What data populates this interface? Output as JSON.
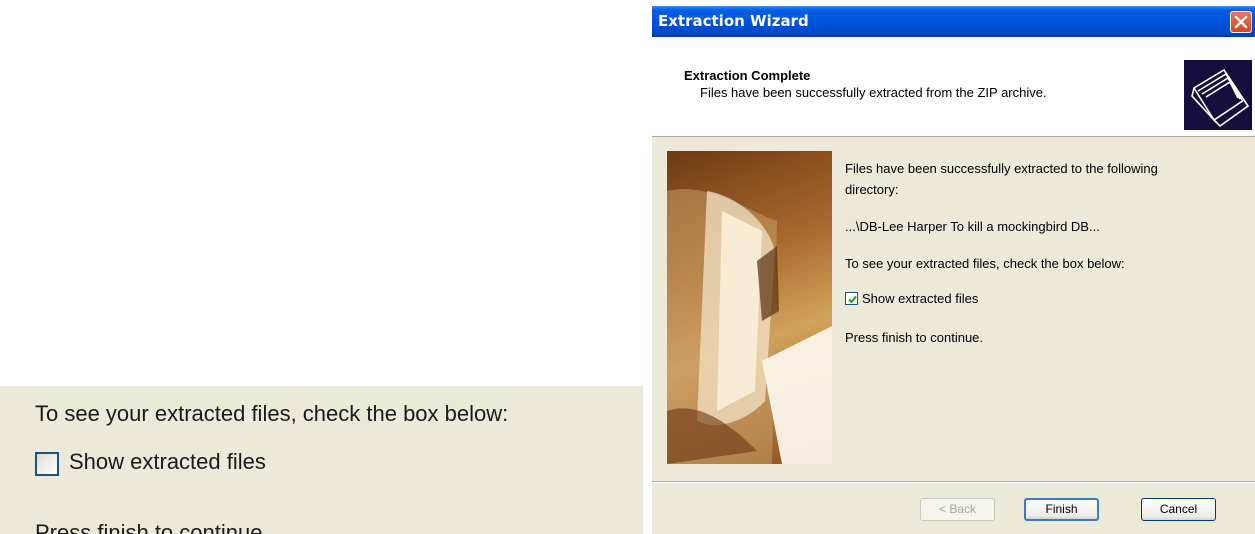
{
  "zoom_crop": {
    "instruction": "To see your extracted files, check the box below:",
    "checkbox_label": "Show extracted files",
    "checkbox_checked": false,
    "cut_text": "Press finish to continue."
  },
  "wizard": {
    "title": "Extraction Wizard",
    "header": {
      "title": "Extraction Complete",
      "subtitle": "Files have been successfully extracted from the ZIP archive."
    },
    "body": {
      "line1": "Files have been successfully extracted to the following",
      "line2": "directory:",
      "path": "...\\DB-Lee Harper To kill a mockingbird DB...",
      "instruction": "To see your extracted files, check the box below:",
      "checkbox_label": "Show extracted files",
      "checkbox_checked": true,
      "continue_text": "Press finish to continue."
    },
    "buttons": {
      "back": "< Back",
      "finish": "Finish",
      "cancel": "Cancel"
    },
    "colors": {
      "titlebar": "#0054e3",
      "dialog_bg": "#ece9d8",
      "close_button": "#d9461f"
    }
  }
}
